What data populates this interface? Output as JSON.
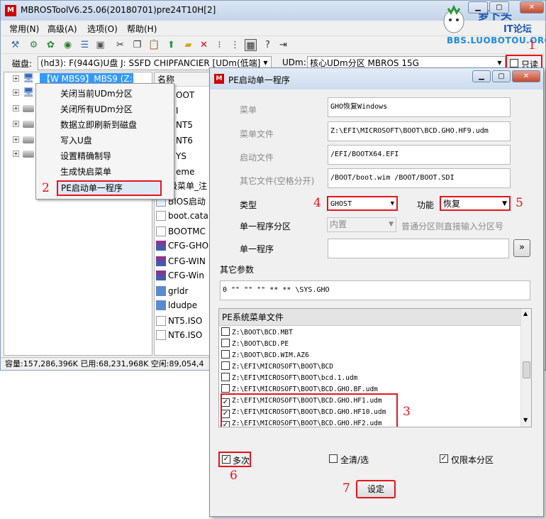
{
  "main_window": {
    "title": "MBROSToolV6.25.06(20180701)pre24T10H[2]",
    "app_icon": "M"
  },
  "menubar": [
    "常用(N)",
    "高级(A)",
    "选项(O)",
    "帮助(H)"
  ],
  "toolbar_icons": [
    "wrench-icon",
    "gear-icon",
    "settings-icon",
    "globe-icon",
    "list-icon",
    "screen-icon",
    "scissors-icon",
    "copy-icon",
    "paste-icon",
    "arrow-up-icon",
    "folder-icon",
    "delete-icon",
    "tree-icon",
    "hierarchy-icon",
    "grid-icon",
    "help-icon",
    "exit-icon"
  ],
  "diskbar": {
    "disk_label": "磁盘:",
    "disk_value": "(hd3): F(944G)U盘  J: SSFD  CHIPFANCIER [UDm(低端]",
    "udm_label": "UDm:",
    "udm_value": "核心UDm分区 MBROS 15G",
    "readonly_label": "只读"
  },
  "tree": {
    "selected_item": "【W MBS9】MBS9 (Z:)"
  },
  "filelist": {
    "header": "名称",
    "items": [
      "OOT",
      "I",
      "NT5",
      "NT6",
      "YS",
      "eme",
      "级菜单_注",
      "BIOS启动",
      "boot.cata",
      "BOOTMC",
      "CFG-GHO",
      "CFG-WIN",
      "CFG-Win",
      "grldr",
      "ldudpe",
      "NT5.ISO",
      "NT6.ISO"
    ]
  },
  "statusbar": "容量:157,286,396K 已用:68,231,968K 空闲:89,054,4",
  "context_menu": [
    "关闭当前UDm分区",
    "关闭所有UDm分区",
    "数据立即刷新到磁盘",
    "写入U盘",
    "设置精确制导",
    "生成快启菜单",
    "PE启动单一程序"
  ],
  "logo": {
    "main": "萝卜头",
    "sub": "IT论坛",
    "url": "BBS.LUOBOTOU.ORG"
  },
  "dialog": {
    "title": "PE启动单一程序",
    "menu_label": "菜单",
    "menu_value": "GHO恢复Windows",
    "menu_file_label": "菜单文件",
    "menu_file_value": "Z:\\EFI\\MICROSOFT\\BOOT\\BCD.GHO.HF9.udm",
    "boot_file_label": "启动文件",
    "boot_file_value": "/EFI/BOOTX64.EFI",
    "other_files_label": "其它文件(空格分开)",
    "other_files_value": "/BOOT/boot.wim /BOOT/BOOT.SDI",
    "type_label": "类型",
    "type_value": "GHOST",
    "function_label": "功能",
    "function_value": "恢复",
    "partition_label": "单一程序分区",
    "partition_value": "内置",
    "partition_hint": "普通分区则直接输入分区号",
    "program_label": "单一程序",
    "program_value": "",
    "browse_label": "»",
    "params_label": "其它参数",
    "params_value": "0 \"\" \"\"  \"\" ** **   \\SYS.GHO",
    "list_header": "PE系统菜单文件",
    "list_items": [
      {
        "path": "Z:\\BOOT\\BCD.MBT",
        "checked": false
      },
      {
        "path": "Z:\\BOOT\\BCD.PE",
        "checked": false
      },
      {
        "path": "Z:\\BOOT\\BCD.WIM.AZ6",
        "checked": false
      },
      {
        "path": "Z:\\EFI\\MICROSOFT\\BOOT\\BCD",
        "checked": false
      },
      {
        "path": "Z:\\EFI\\MICROSOFT\\BOOT\\bcd.1.udm",
        "checked": false
      },
      {
        "path": "Z:\\EFI\\MICROSOFT\\BOOT\\BCD.GHO.BF.udm",
        "checked": false
      },
      {
        "path": "Z:\\EFI\\MICROSOFT\\BOOT\\BCD.GHO.HF1.udm",
        "checked": true
      },
      {
        "path": "Z:\\EFI\\MICROSOFT\\BOOT\\BCD.GHO.HF10.udm",
        "checked": true
      },
      {
        "path": "Z:\\EFI\\MICROSOFT\\BOOT\\BCD.GHO.HF2.udm",
        "checked": true
      }
    ],
    "multi_label": "多次",
    "select_all_label": "全清/选",
    "this_partition_label": "仅限本分区",
    "set_button": "设定"
  },
  "annotations": [
    "1",
    "2",
    "3",
    "4",
    "5",
    "6",
    "7"
  ],
  "colors": {
    "highlight_red": "#e8131b",
    "selection_blue": "#3399ff",
    "logo_blue": "#1c56b0"
  }
}
